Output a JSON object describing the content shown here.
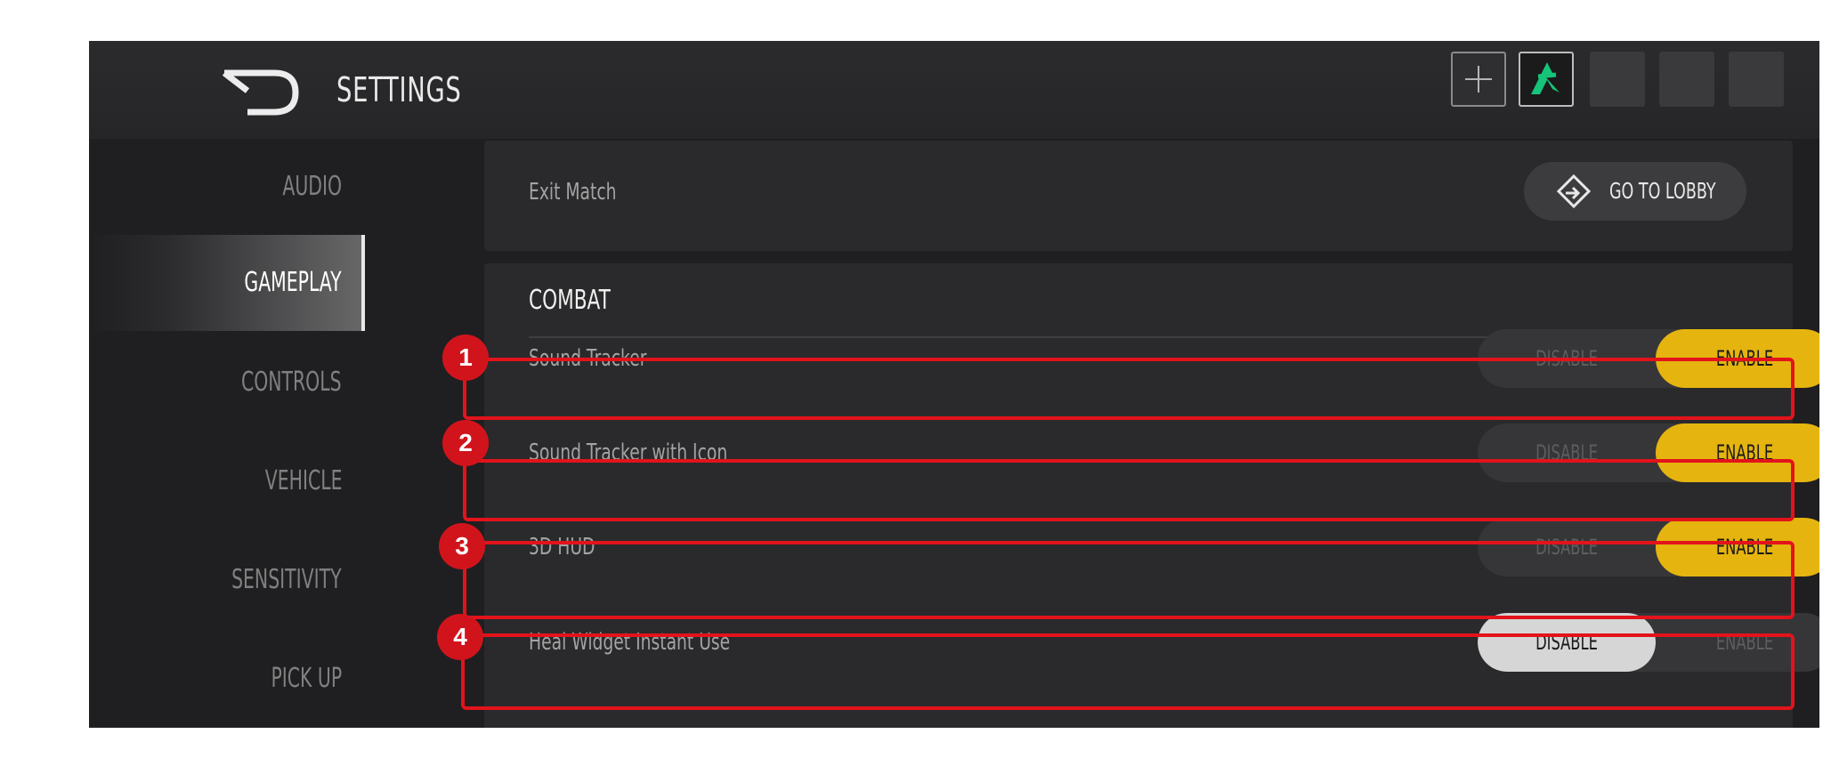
{
  "header": {
    "title": "SETTINGS"
  },
  "sidebar": {
    "items": [
      {
        "label": "AUDIO",
        "active": false
      },
      {
        "label": "GAMEPLAY",
        "active": true
      },
      {
        "label": "CONTROLS",
        "active": false
      },
      {
        "label": "VEHICLE",
        "active": false
      },
      {
        "label": "SENSITIVITY",
        "active": false
      },
      {
        "label": "PICK UP",
        "active": false
      }
    ]
  },
  "exit_match": {
    "label": "Exit Match",
    "button_label": "GO TO LOBBY"
  },
  "combat": {
    "title": "COMBAT",
    "rows": [
      {
        "label": "Sound Tracker",
        "disable": "DISABLE",
        "enable": "ENABLE",
        "selected": "ENABLE"
      },
      {
        "label": "Sound Tracker with Icon",
        "disable": "DISABLE",
        "enable": "ENABLE",
        "selected": "ENABLE"
      },
      {
        "label": "3D HUD",
        "disable": "DISABLE",
        "enable": "ENABLE",
        "selected": "ENABLE"
      },
      {
        "label": "Heal Widget Instant Use",
        "disable": "DISABLE",
        "enable": "ENABLE",
        "selected": "DISABLE"
      }
    ]
  },
  "annotations": {
    "badges": [
      "1",
      "2",
      "3",
      "4"
    ]
  },
  "colors": {
    "accent_enable": "#e5b40f",
    "annotation_red": "#e3131b",
    "avatar_green": "#16c47a"
  }
}
